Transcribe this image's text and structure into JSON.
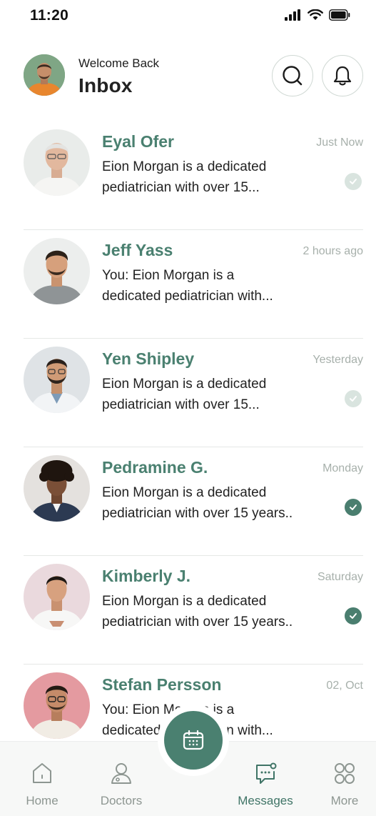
{
  "status_bar": {
    "time": "11:20"
  },
  "header": {
    "welcome": "Welcome Back",
    "title": "Inbox"
  },
  "conversations": [
    {
      "name": "Eyal Ofer",
      "time": "Just Now",
      "line1": "Eion Morgan is a dedicated",
      "line2": "pediatrician with over 15...",
      "status": "light"
    },
    {
      "name": "Jeff Yass",
      "time": "2 hours ago",
      "line1": "You: Eion Morgan is a",
      "line2": "dedicated pediatrician with...",
      "status": "none"
    },
    {
      "name": "Yen Shipley",
      "time": "Yesterday",
      "line1": "Eion Morgan is a dedicated",
      "line2": "pediatrician with over 15...",
      "status": "light"
    },
    {
      "name": "Pedramine G.",
      "time": "Monday",
      "line1": "Eion Morgan is a dedicated",
      "line2": "pediatrician with over 15 years..",
      "status": "read"
    },
    {
      "name": "Kimberly J.",
      "time": "Saturday",
      "line1": "Eion Morgan is a dedicated",
      "line2": "pediatrician with over 15 years..",
      "status": "read"
    },
    {
      "name": "Stefan Persson",
      "time": "02, Oct",
      "line1": "You: Eion Morgan is a",
      "line2": "dedicated pediatrician with...",
      "status": "none"
    }
  ],
  "bottom_nav": {
    "home": "Home",
    "doctors": "Doctors",
    "messages": "Messages",
    "more": "More"
  },
  "colors": {
    "accent": "#4a8070",
    "active_nav": "#3f7466",
    "muted": "#a7b0ab"
  },
  "icons": [
    "search-icon",
    "bell-icon",
    "home-icon",
    "doctor-icon",
    "calendar-icon",
    "message-icon",
    "grid-icon",
    "check-icon"
  ]
}
